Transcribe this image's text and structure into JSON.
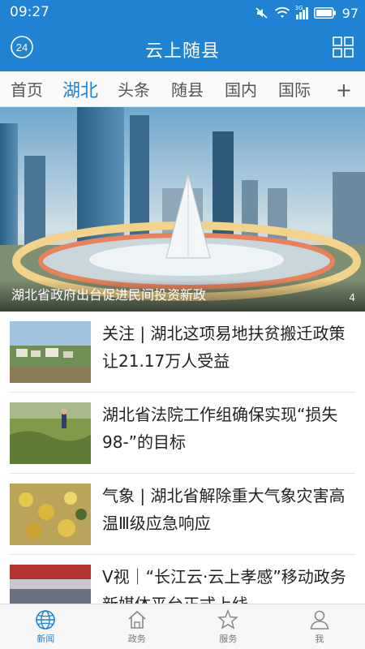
{
  "status_bar": {
    "time": "09:27",
    "battery": "97",
    "signal_label": "3G"
  },
  "header": {
    "title": "云上随县",
    "left_icon_text": "24"
  },
  "tabs": [
    {
      "label": "首页",
      "active": false
    },
    {
      "label": "湖北",
      "active": true
    },
    {
      "label": "头条",
      "active": false
    },
    {
      "label": "随县",
      "active": false
    },
    {
      "label": "国内",
      "active": false
    },
    {
      "label": "国际",
      "active": false
    }
  ],
  "tabs_add": "+",
  "hero": {
    "caption": "湖北省政府出台促进民间投资新政",
    "pager": "4"
  },
  "news": [
    {
      "title": "关注 | 湖北这项易地扶贫搬迁政策 让21.17万人受益"
    },
    {
      "title": "湖北省法院工作组确保实现“损失98-”的目标"
    },
    {
      "title": "气象 | 湖北省解除重大气象灾害高温Ⅲ级应急响应"
    },
    {
      "title": "V视｜“长江云·云上孝感”移动政务新媒体平台正式上线"
    }
  ],
  "bottom_nav": [
    {
      "label": "新闻",
      "icon": "globe-icon",
      "active": true
    },
    {
      "label": "政务",
      "icon": "house-icon",
      "active": false
    },
    {
      "label": "服务",
      "icon": "star-icon",
      "active": false
    },
    {
      "label": "我",
      "icon": "person-icon",
      "active": false
    }
  ],
  "colors": {
    "brand": "#1f82d2"
  }
}
